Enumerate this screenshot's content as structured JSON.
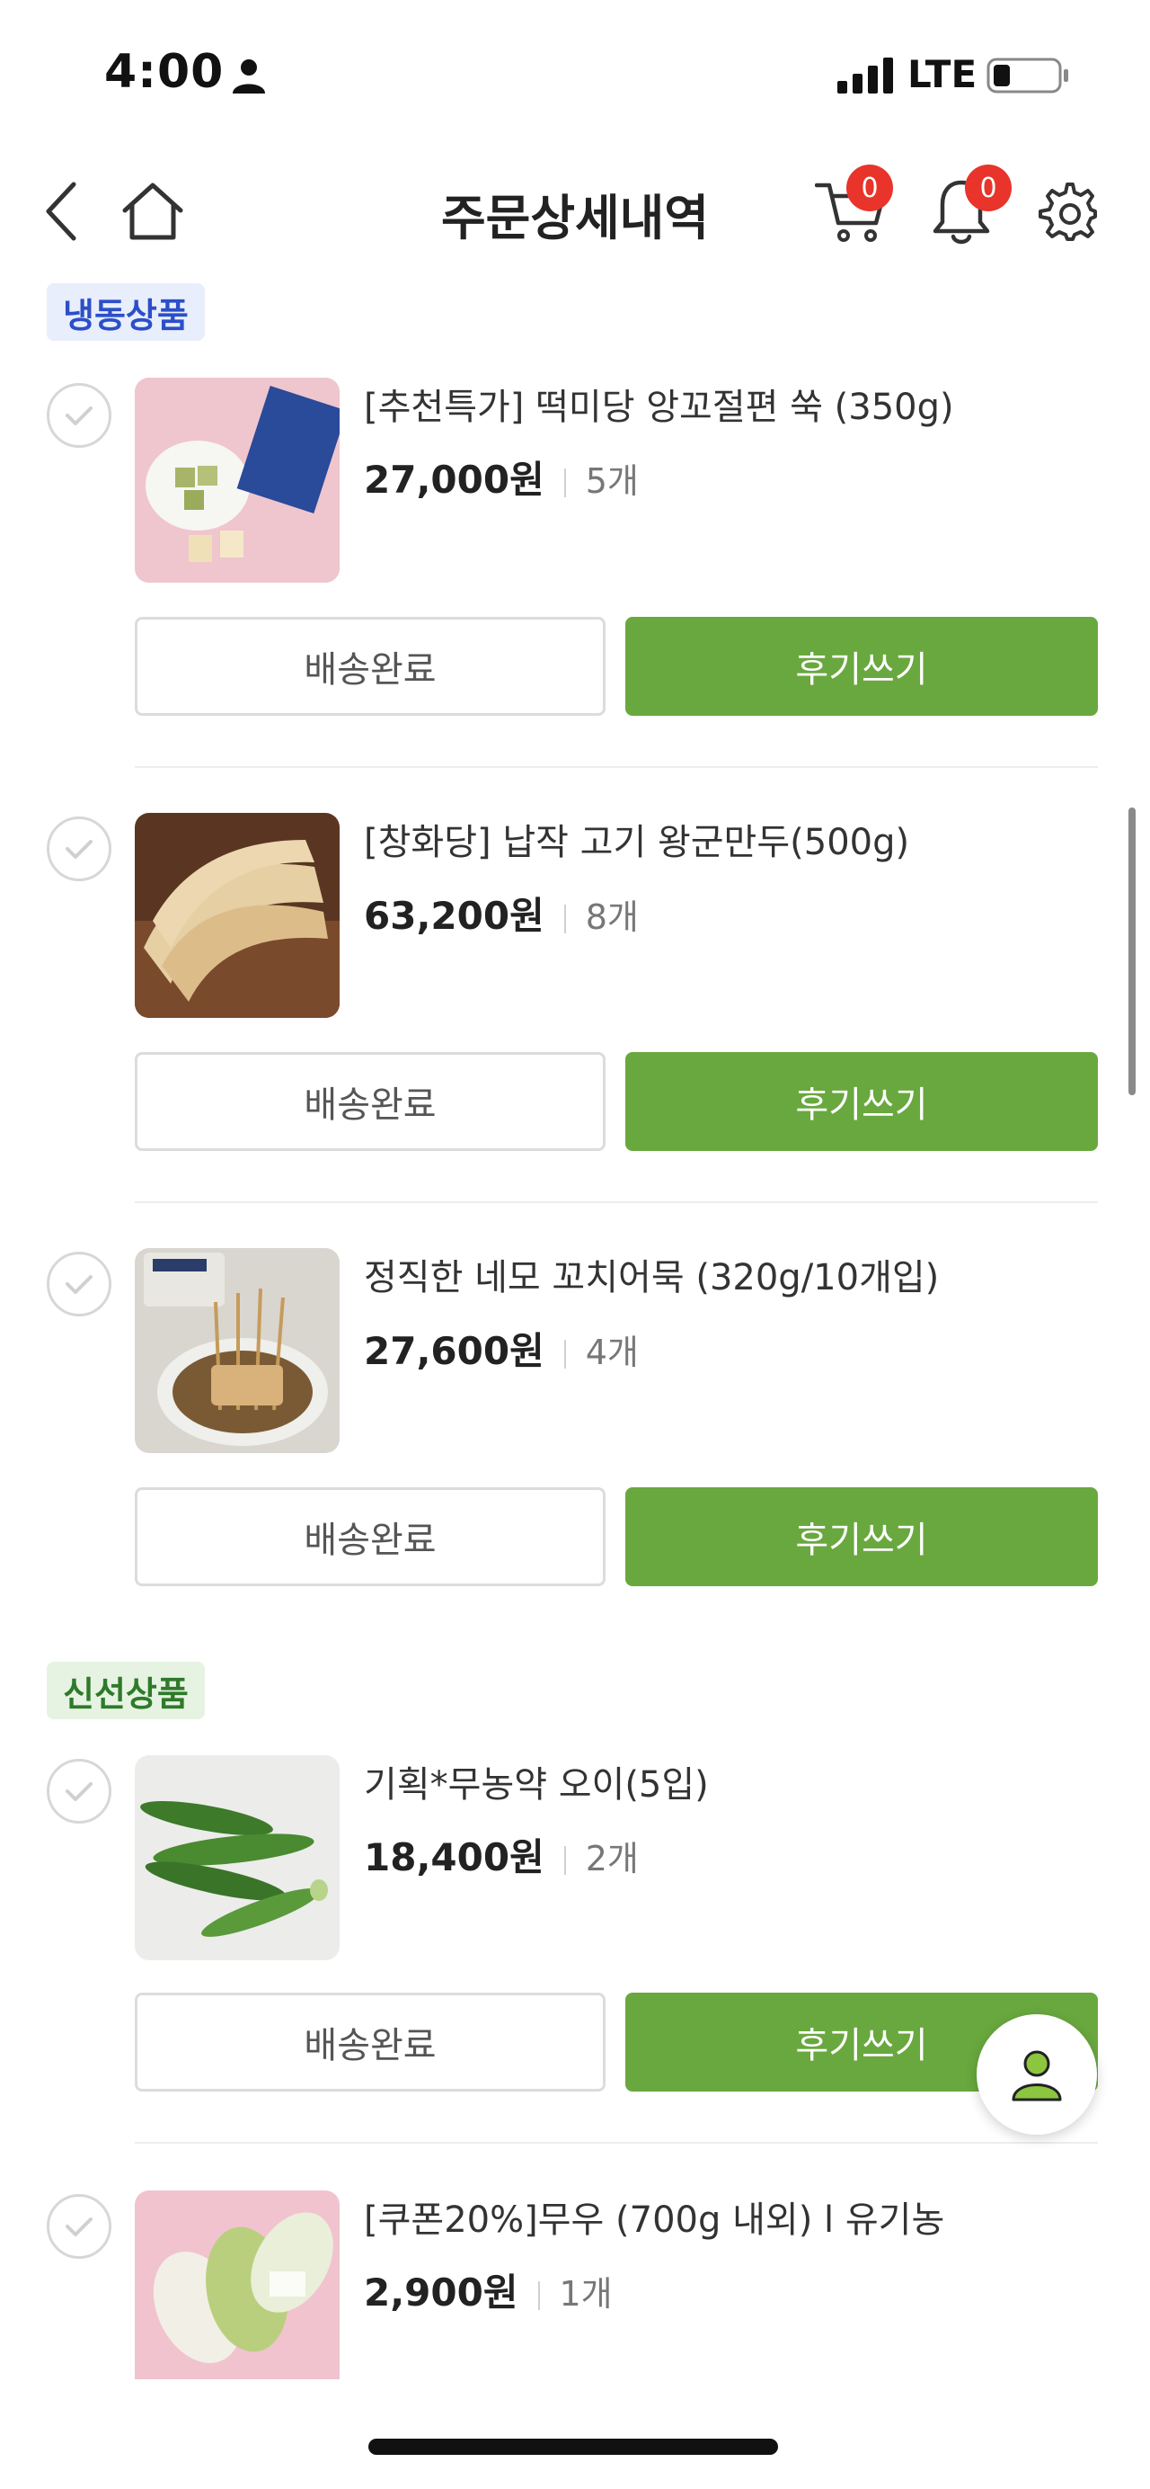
{
  "status_bar": {
    "time": "4:00",
    "network": "LTE"
  },
  "header": {
    "title": "주문상세내역",
    "cart_count": "0",
    "notification_count": "0",
    "icons": [
      "back-icon",
      "home-icon",
      "cart-icon",
      "bell-icon",
      "gear-icon"
    ]
  },
  "sections": [
    {
      "tag": "냉동상품",
      "products": [
        {
          "name": "[추천특가] 떡미당 앙꼬절편 쑥 (350g)",
          "price": "27,000원",
          "qty": "5개",
          "status_button": "배송완료",
          "review_button": "후기쓰기"
        },
        {
          "name": "[창화당] 납작 고기 왕군만두(500g)",
          "price": "63,200원",
          "qty": "8개",
          "status_button": "배송완료",
          "review_button": "후기쓰기"
        },
        {
          "name": "정직한 네모 꼬치어묵 (320g/10개입)",
          "price": "27,600원",
          "qty": "4개",
          "status_button": "배송완료",
          "review_button": "후기쓰기"
        }
      ]
    },
    {
      "tag": "신선상품",
      "products": [
        {
          "name": "기획*무농약 오이(5입)",
          "price": "18,400원",
          "qty": "2개",
          "status_button": "배송완료",
          "review_button": "후기쓰기"
        },
        {
          "name": "[쿠폰20%]무우 (700g 내외) l 유기농",
          "price": "2,900원",
          "qty": "1개"
        }
      ]
    }
  ],
  "colors": {
    "accent_green": "#69a83e",
    "badge_red": "#e8342a",
    "frozen_tag": "#2c4fc8",
    "fresh_tag": "#2f7a2a"
  }
}
